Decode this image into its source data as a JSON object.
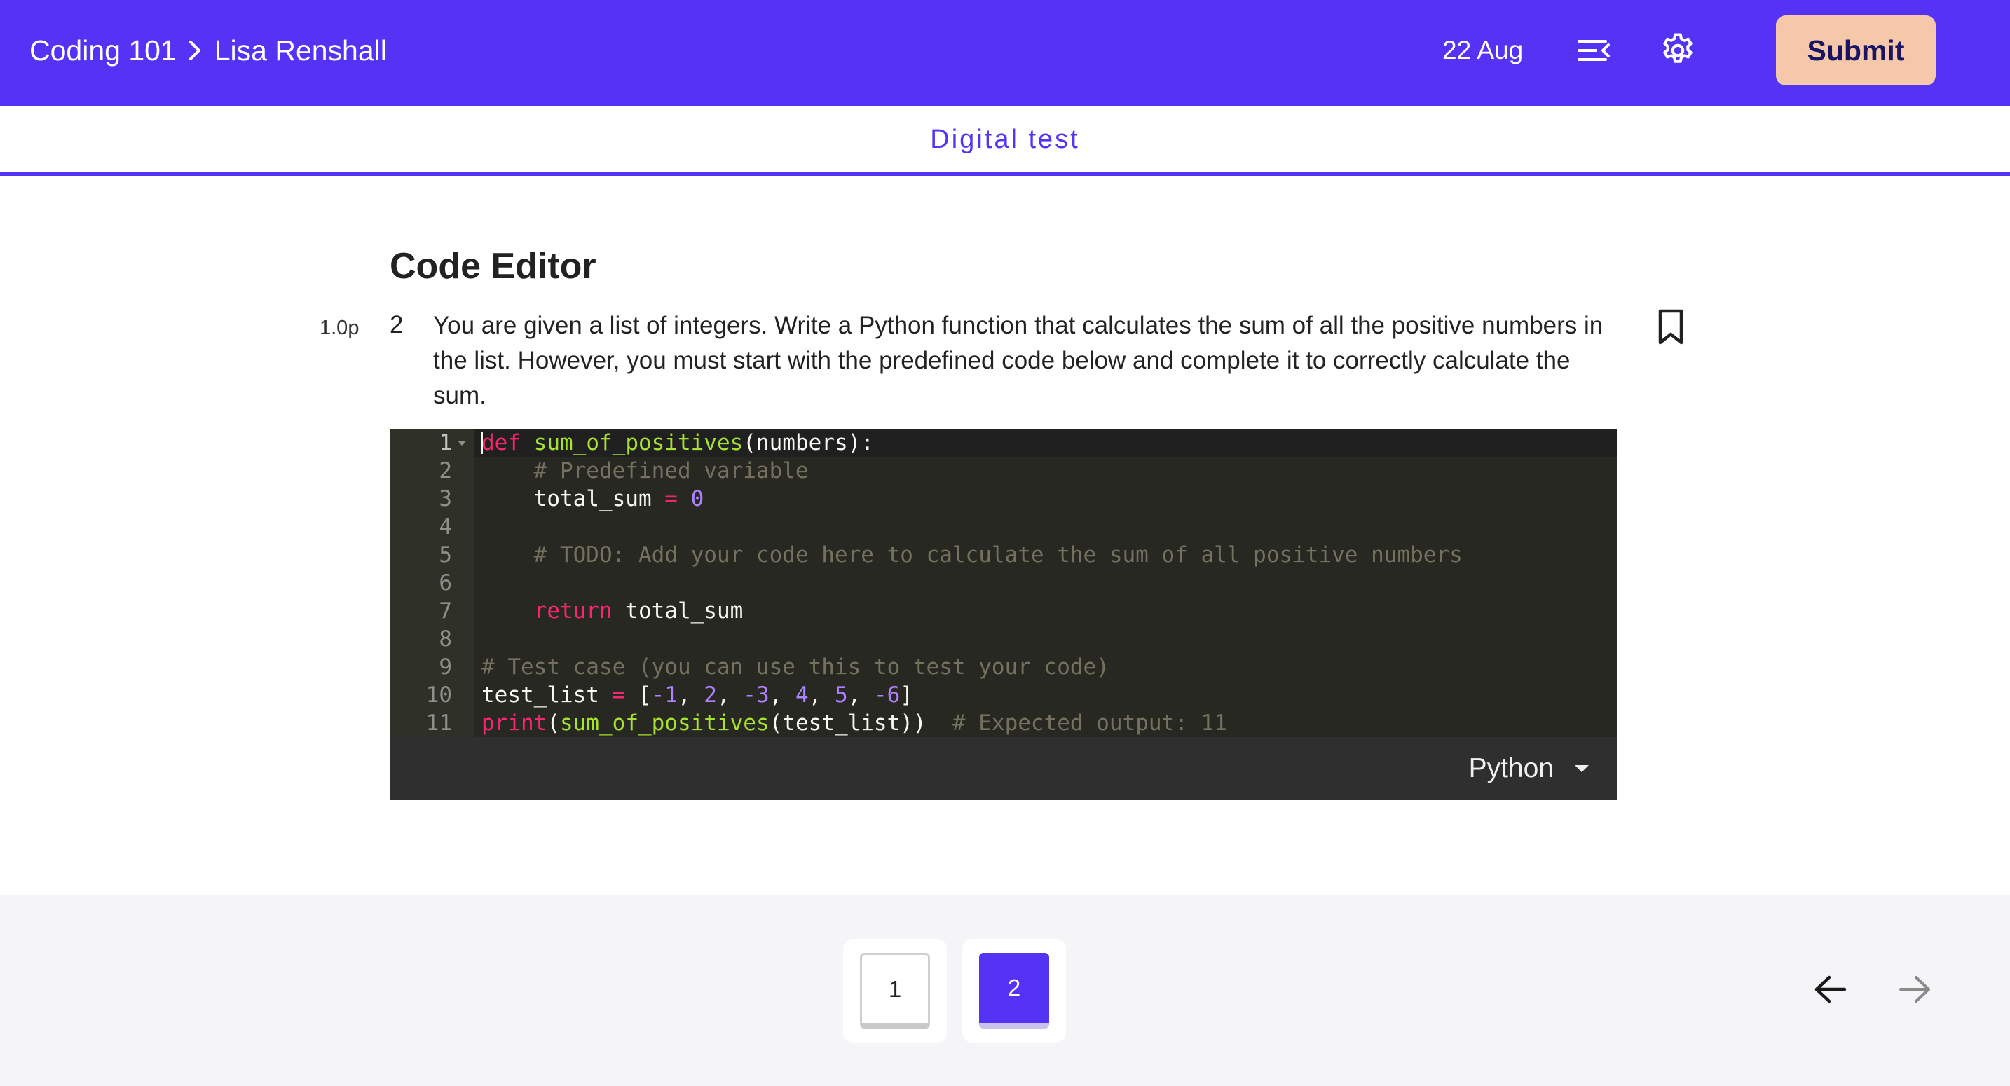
{
  "header": {
    "course": "Coding 101",
    "user": "Lisa Renshall",
    "date": "22 Aug",
    "submit_label": "Submit",
    "icons": [
      "breadcrumb-chevron-icon",
      "collapse-list-icon",
      "gear-icon"
    ],
    "background_color": "#5433f5",
    "submit_color": "#f4c8a8"
  },
  "subheader": {
    "title": "Digital test"
  },
  "question": {
    "section_title": "Code Editor",
    "points": "1.0p",
    "number": "2",
    "text": "You are given a list of integers. Write a Python function that calculates the sum of all the positive numbers in the list. However, you must start with the predefined code below and complete it to correctly calculate the sum.",
    "bookmark_icon": "bookmark-icon"
  },
  "editor": {
    "line_numbers": [
      "1",
      "2",
      "3",
      "4",
      "5",
      "6",
      "7",
      "8",
      "9",
      "10",
      "11"
    ],
    "code_lines": [
      "def sum_of_positives(numbers):",
      "    # Predefined variable",
      "    total_sum = 0",
      "",
      "    # TODO: Add your code here to calculate the sum of all positive numbers",
      "",
      "    return total_sum",
      "",
      "# Test case (you can use this to test your code)",
      "test_list = [-1, 2, -3, 4, 5, -6]",
      "print(sum_of_positives(test_list))  # Expected output: 11"
    ],
    "language": "Python",
    "theme_colors": {
      "background": "#272822",
      "keyword": "#f92672",
      "function": "#a6e22e",
      "number": "#ae81ff",
      "comment": "#75715e"
    }
  },
  "pagination": {
    "pages": [
      "1",
      "2"
    ],
    "current_page": "2",
    "prev_icon": "arrow-left-icon",
    "next_icon": "arrow-right-icon",
    "accent_color": "#5433f5"
  }
}
